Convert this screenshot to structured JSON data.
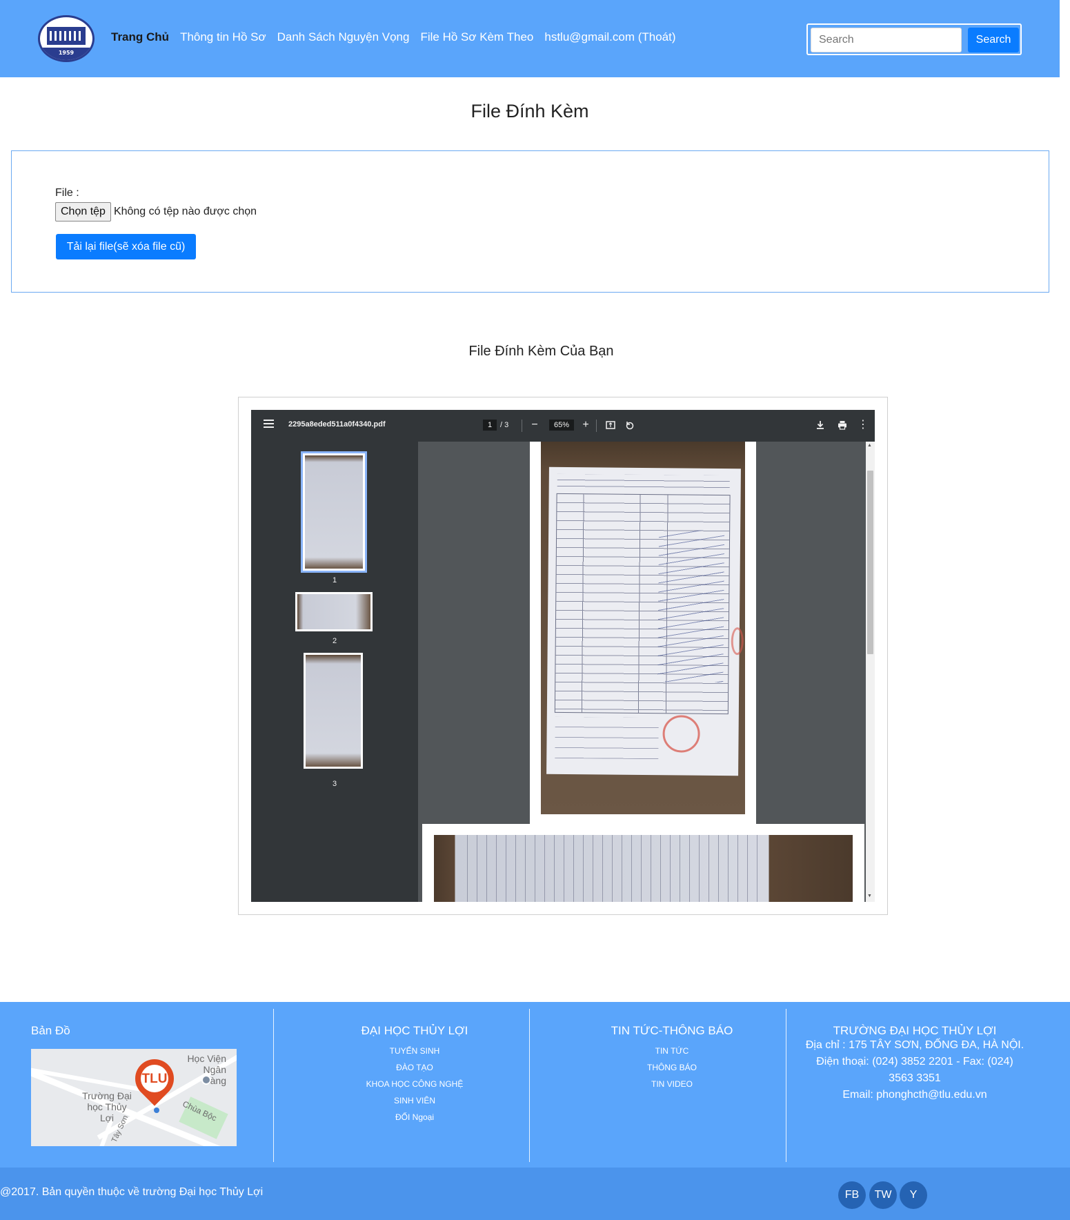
{
  "nav": {
    "logo_year": "1959",
    "items": [
      {
        "label": "Trang Chủ",
        "active": true
      },
      {
        "label": "Thông tin Hồ Sơ",
        "active": false
      },
      {
        "label": "Danh Sách Nguyện Vọng",
        "active": false
      },
      {
        "label": "File Hồ Sơ Kèm Theo",
        "active": false
      },
      {
        "label": "hstlu@gmail.com (Thoát)",
        "active": false
      }
    ],
    "search_placeholder": "Search",
    "search_button": "Search"
  },
  "page": {
    "title": "File Đính Kèm",
    "file_label": "File :",
    "choose_button": "Chọn tệp",
    "file_status": "Không có tệp nào được chọn",
    "reupload_button": "Tải lại file(sẽ xóa file cũ)",
    "attached_title": "File Đính Kèm Của Bạn"
  },
  "pdf_viewer": {
    "filename": "2295a8eded511a0f4340.pdf",
    "current_page": "1",
    "page_separator": "/",
    "total_pages": "3",
    "zoom": "65%",
    "thumbnails": [
      "1",
      "2",
      "3"
    ]
  },
  "footer": {
    "map_title": "Bản Đồ",
    "map_labels": {
      "place1": "Học Viện Ngân Hàng",
      "place2": "Trường Đại học Thủy Lợi",
      "place3": "Chùa Bộc",
      "street": "Tây Sơn",
      "pin": "TLU"
    },
    "col2": {
      "title": "ĐẠI HỌC THỦY LỢI",
      "links": [
        "TUYỂN SINH",
        "ĐÀO TẠO",
        "KHOA HỌC CÔNG NGHỆ",
        "SINH VIÊN",
        "ĐỐI Ngoại"
      ]
    },
    "col3": {
      "title": "TIN TỨC-THÔNG BÁO",
      "links": [
        "TIN TỨC",
        "THÔNG BÁO",
        "TIN VIDEO"
      ]
    },
    "col4": {
      "title": "TRƯỜNG ĐẠI HỌC THỦY LỢI",
      "address": "Địa chỉ : 175 TÂY SƠN, ĐỐNG ĐA, HÀ NỘI.",
      "phone": "Điện thoại: (024) 3852 2201 - Fax: (024) 3563 3351",
      "email": "Email: phonghcth@tlu.edu.vn"
    },
    "copyright": "@2017. Bản quyền thuộc về trường Đại học Thủy Lợi",
    "social": [
      "FB",
      "TW",
      "Y"
    ]
  }
}
